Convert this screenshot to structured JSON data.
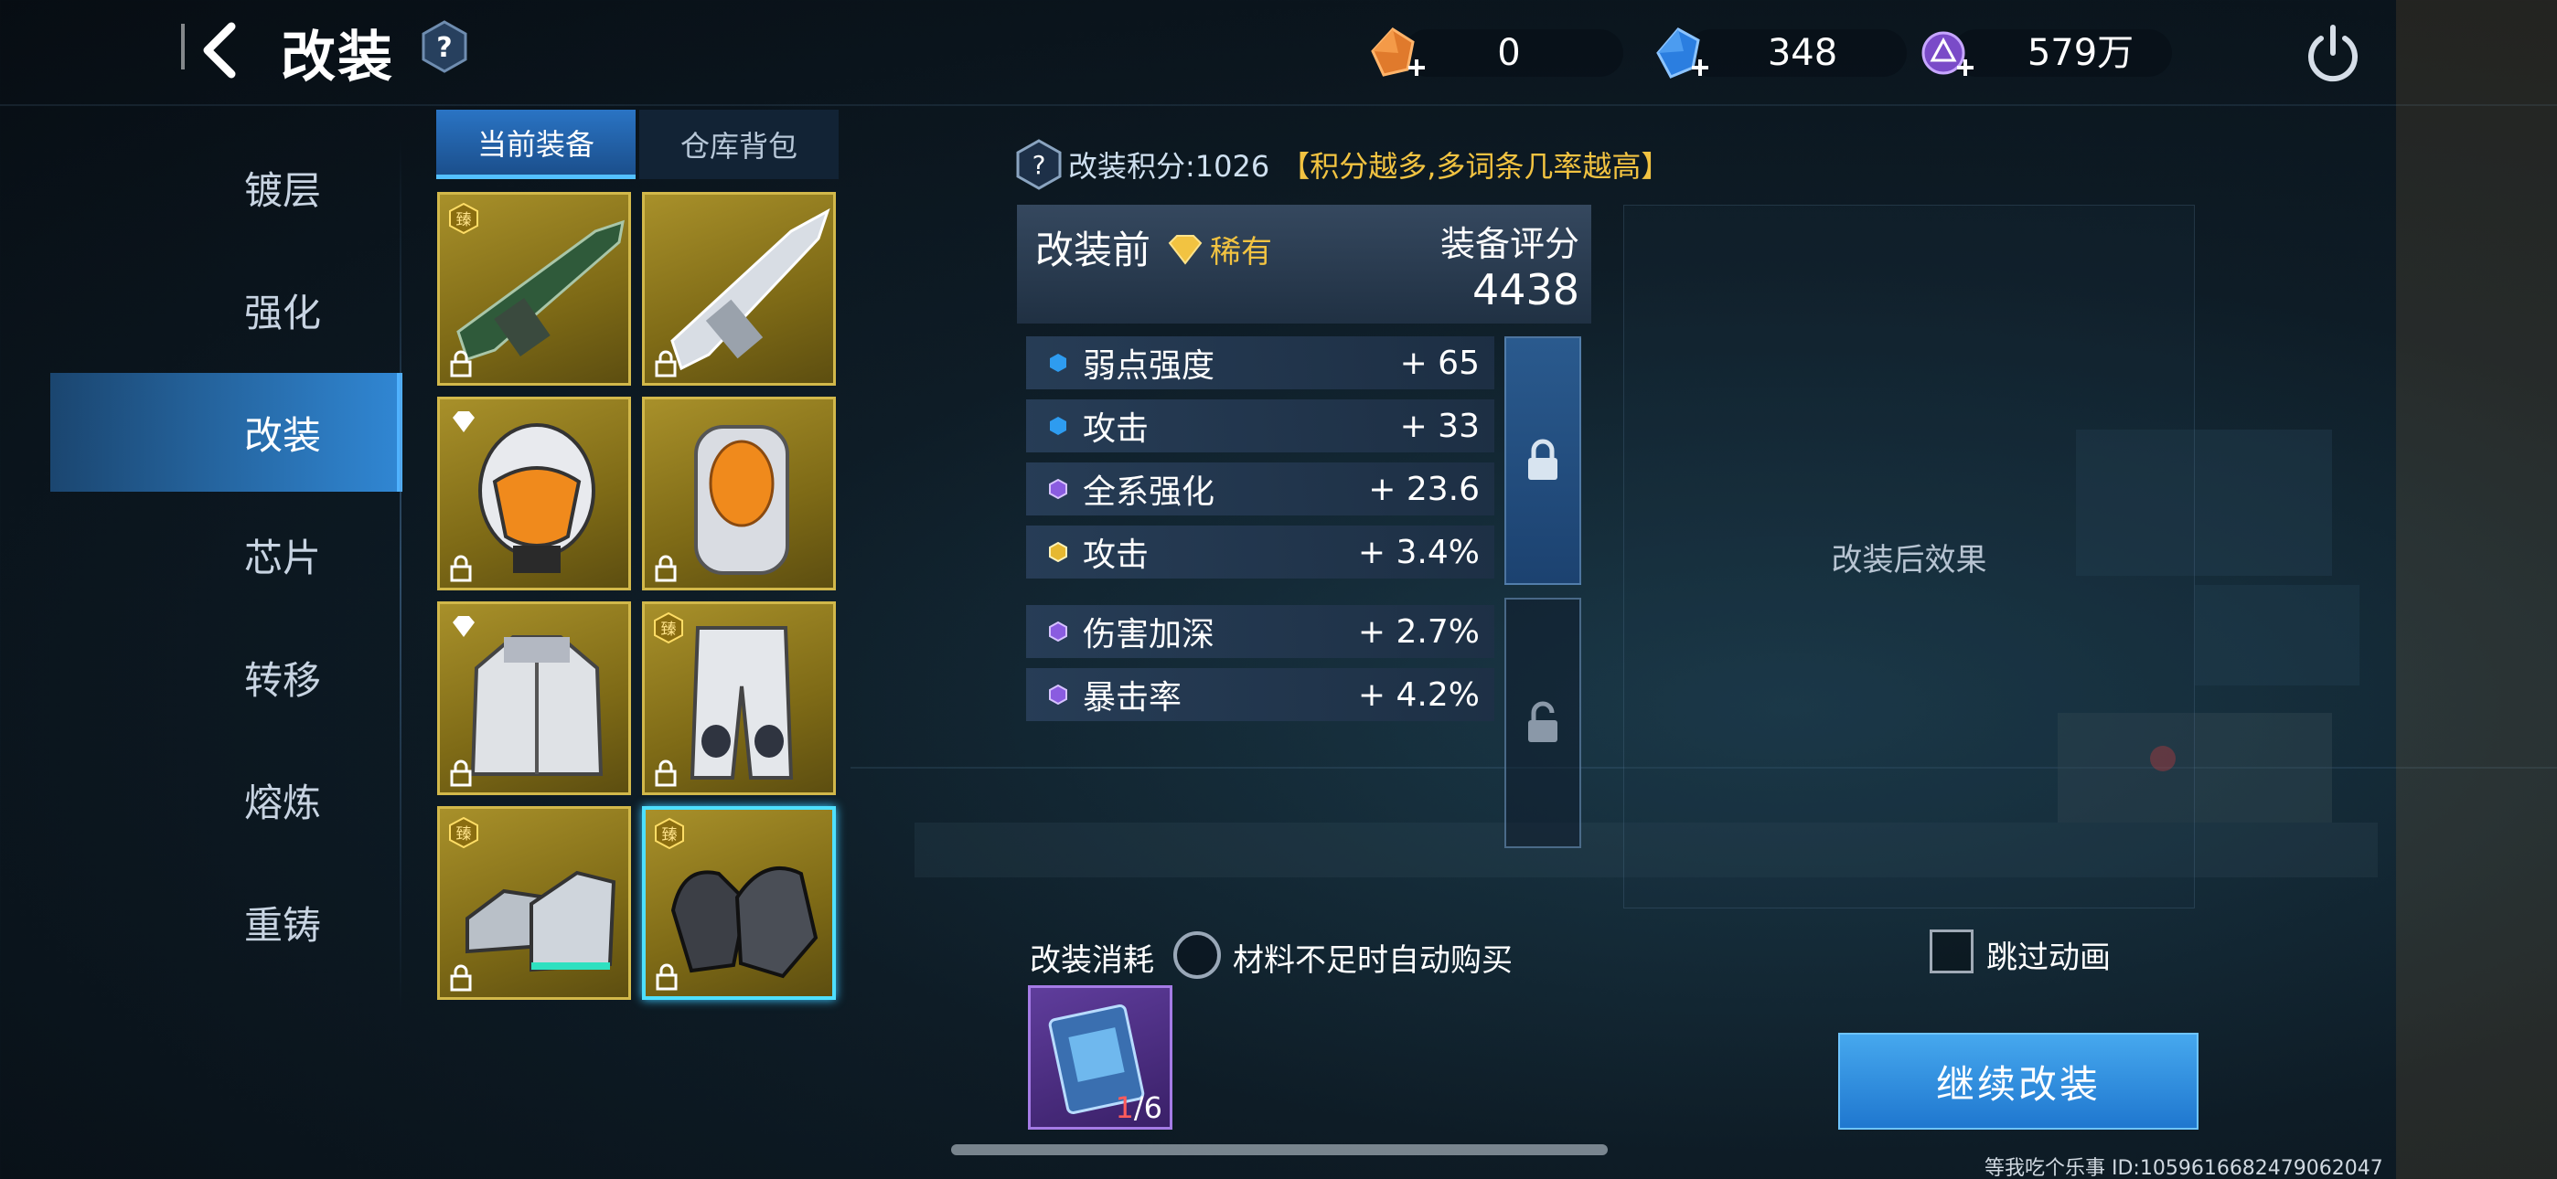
{
  "header": {
    "title": "改装",
    "back_icon": "chevron-left-icon",
    "help_icon": "question-hex-icon"
  },
  "currencies": [
    {
      "name": "orange-crystal",
      "value": "0"
    },
    {
      "name": "blue-crystal",
      "value": "348"
    },
    {
      "name": "purple-coin",
      "value": "579万"
    }
  ],
  "nav": {
    "items": [
      "镀层",
      "强化",
      "改装",
      "芯片",
      "转移",
      "熔炼",
      "重铸"
    ],
    "active": "改装"
  },
  "equip_tabs": {
    "current": "当前装备",
    "storage": "仓库背包"
  },
  "slots": [
    {
      "name": "rifle-green",
      "badge": "臻"
    },
    {
      "name": "rifle-white",
      "badge": ""
    },
    {
      "name": "helmet",
      "badge": "diamond"
    },
    {
      "name": "backpack",
      "badge": ""
    },
    {
      "name": "jacket",
      "badge": "diamond"
    },
    {
      "name": "pants",
      "badge": "臻"
    },
    {
      "name": "boots",
      "badge": "臻"
    },
    {
      "name": "gloves",
      "badge": "臻"
    }
  ],
  "mod": {
    "score_label": "改装积分:1026",
    "score_hint": "【积分越多,多词条几率越高】",
    "before_title": "改装前",
    "rarity": "稀有",
    "rating_label": "装备评分",
    "rating_value": "4438",
    "stats": [
      {
        "name": "弱点强度",
        "value": "+ 65",
        "tier": "blue"
      },
      {
        "name": "攻击",
        "value": "+ 33",
        "tier": "blue"
      },
      {
        "name": "全系强化",
        "value": "+ 23.6",
        "tier": "purple"
      },
      {
        "name": "攻击",
        "value": "+ 3.4%",
        "tier": "gold"
      },
      {
        "name": "伤害加深",
        "value": "+ 2.7%",
        "tier": "purple"
      },
      {
        "name": "暴击率",
        "value": "+ 4.2%",
        "tier": "purple"
      }
    ],
    "after_label": "改装后效果"
  },
  "cost": {
    "label": "改装消耗",
    "autobuy_label": "材料不足时自动购买",
    "material_have": "1",
    "material_need": "/6"
  },
  "skip_label": "跳过动画",
  "continue_label": "继续改装",
  "footer_text": "等我吃个乐事  ID:1059616682479062047",
  "colors": {
    "accent_blue": "#2f8fe0",
    "gold": "#f2c341",
    "slot_gold": "#a8902a"
  }
}
